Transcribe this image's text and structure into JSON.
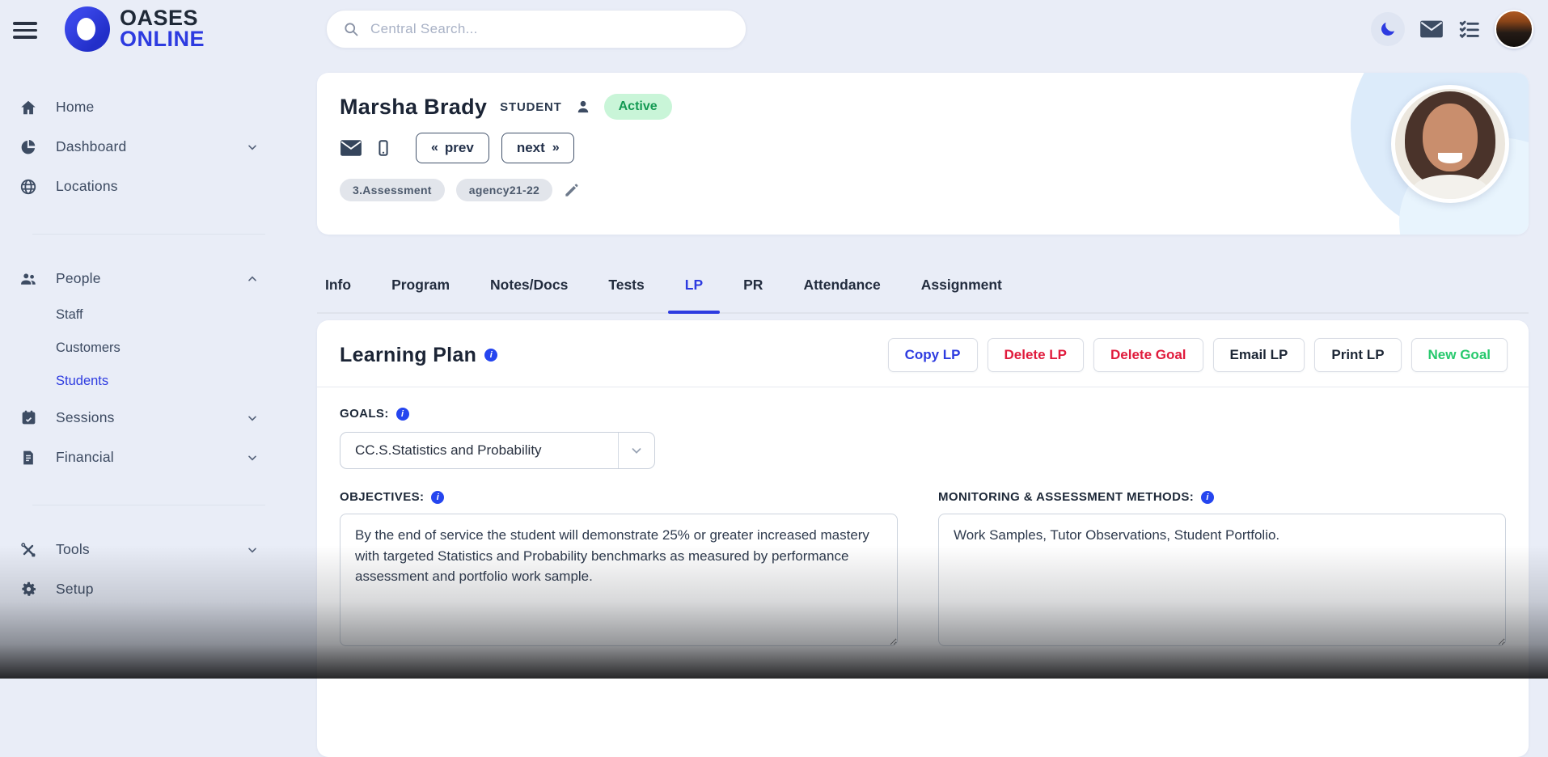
{
  "app": {
    "name_line1": "OASES",
    "name_line2": "ONLINE"
  },
  "topbar": {
    "search_placeholder": "Central Search..."
  },
  "sidebar": {
    "items": [
      {
        "label": "Home"
      },
      {
        "label": "Dashboard"
      },
      {
        "label": "Locations"
      },
      {
        "label": "People"
      },
      {
        "label": "Staff"
      },
      {
        "label": "Customers"
      },
      {
        "label": "Students"
      },
      {
        "label": "Sessions"
      },
      {
        "label": "Financial"
      },
      {
        "label": "Tools"
      },
      {
        "label": "Setup"
      }
    ]
  },
  "student": {
    "name": "Marsha Brady",
    "role_label": "STUDENT",
    "status": "Active",
    "prev_label": "prev",
    "next_label": "next",
    "tags": [
      {
        "label": "3.Assessment"
      },
      {
        "label": "agency21-22"
      }
    ]
  },
  "tabs": {
    "items": [
      "Info",
      "Program",
      "Notes/Docs",
      "Tests",
      "LP",
      "PR",
      "Attendance",
      "Assignment"
    ],
    "active": "LP"
  },
  "learning_plan": {
    "title": "Learning Plan",
    "buttons": [
      {
        "label": "Copy LP"
      },
      {
        "label": "Delete LP"
      },
      {
        "label": "Delete Goal"
      },
      {
        "label": "Email LP"
      },
      {
        "label": "Print LP"
      },
      {
        "label": "New Goal"
      }
    ],
    "goals_label": "GOALS:",
    "goal_value": "CC.S.Statistics and Probability",
    "objectives_label": "OBJECTIVES:",
    "objectives_value": "By the end of service the student will demonstrate 25% or greater increased mastery with targeted Statistics and Probability benchmarks as measured by performance assessment and portfolio work sample.",
    "monitoring_label": "MONITORING & ASSESSMENT METHODS:",
    "monitoring_value": "Work Samples, Tutor Observations, Student Portfolio."
  },
  "colors": {
    "accent_blue": "#2d3be0",
    "danger_red": "#e01b3c",
    "success_green": "#27c96d",
    "active_badge_bg": "#c9f5d8",
    "active_badge_text": "#149a53",
    "background": "#e9edf7",
    "text_dark": "#1c2636",
    "sidebar_text": "#3c4a61"
  }
}
